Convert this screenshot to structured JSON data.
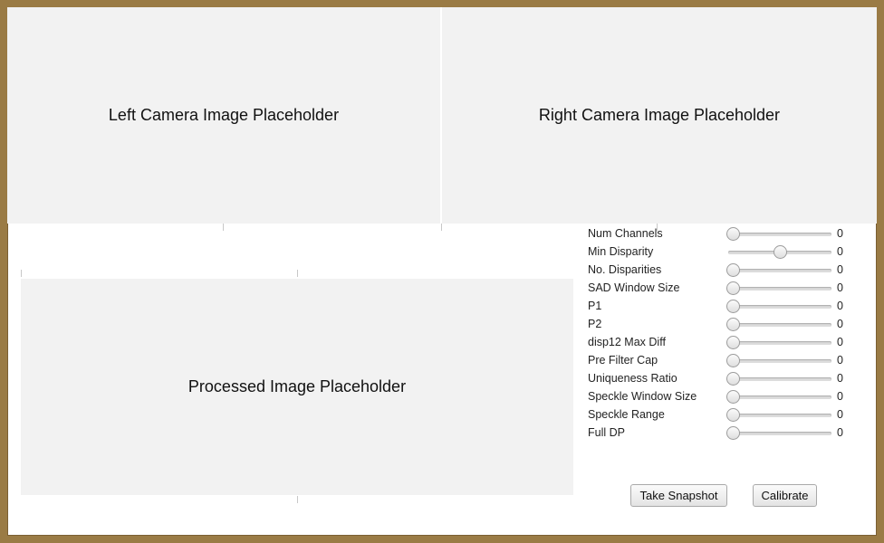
{
  "panels": {
    "left_camera": "Left Camera Image Placeholder",
    "right_camera": "Right Camera Image Placeholder",
    "processed": "Processed Image Placeholder"
  },
  "controls": [
    {
      "label": "Num Channels",
      "value": "0",
      "level": 0.0
    },
    {
      "label": "Min Disparity",
      "value": "0",
      "level": 0.5
    },
    {
      "label": "No. Disparities",
      "value": "0",
      "level": 0.0
    },
    {
      "label": "SAD Window Size",
      "value": "0",
      "level": 0.0
    },
    {
      "label": "P1",
      "value": "0",
      "level": 0.0
    },
    {
      "label": "P2",
      "value": "0",
      "level": 0.0
    },
    {
      "label": "disp12 Max Diff",
      "value": "0",
      "level": 0.0
    },
    {
      "label": "Pre Filter Cap",
      "value": "0",
      "level": 0.0
    },
    {
      "label": "Uniqueness Ratio",
      "value": "0",
      "level": 0.0
    },
    {
      "label": "Speckle Window Size",
      "value": "0",
      "level": 0.0
    },
    {
      "label": "Speckle Range",
      "value": "0",
      "level": 0.0
    },
    {
      "label": "Full DP",
      "value": "0",
      "level": 0.0
    }
  ],
  "buttons": {
    "snapshot": "Take Snapshot",
    "calibrate": "Calibrate"
  }
}
